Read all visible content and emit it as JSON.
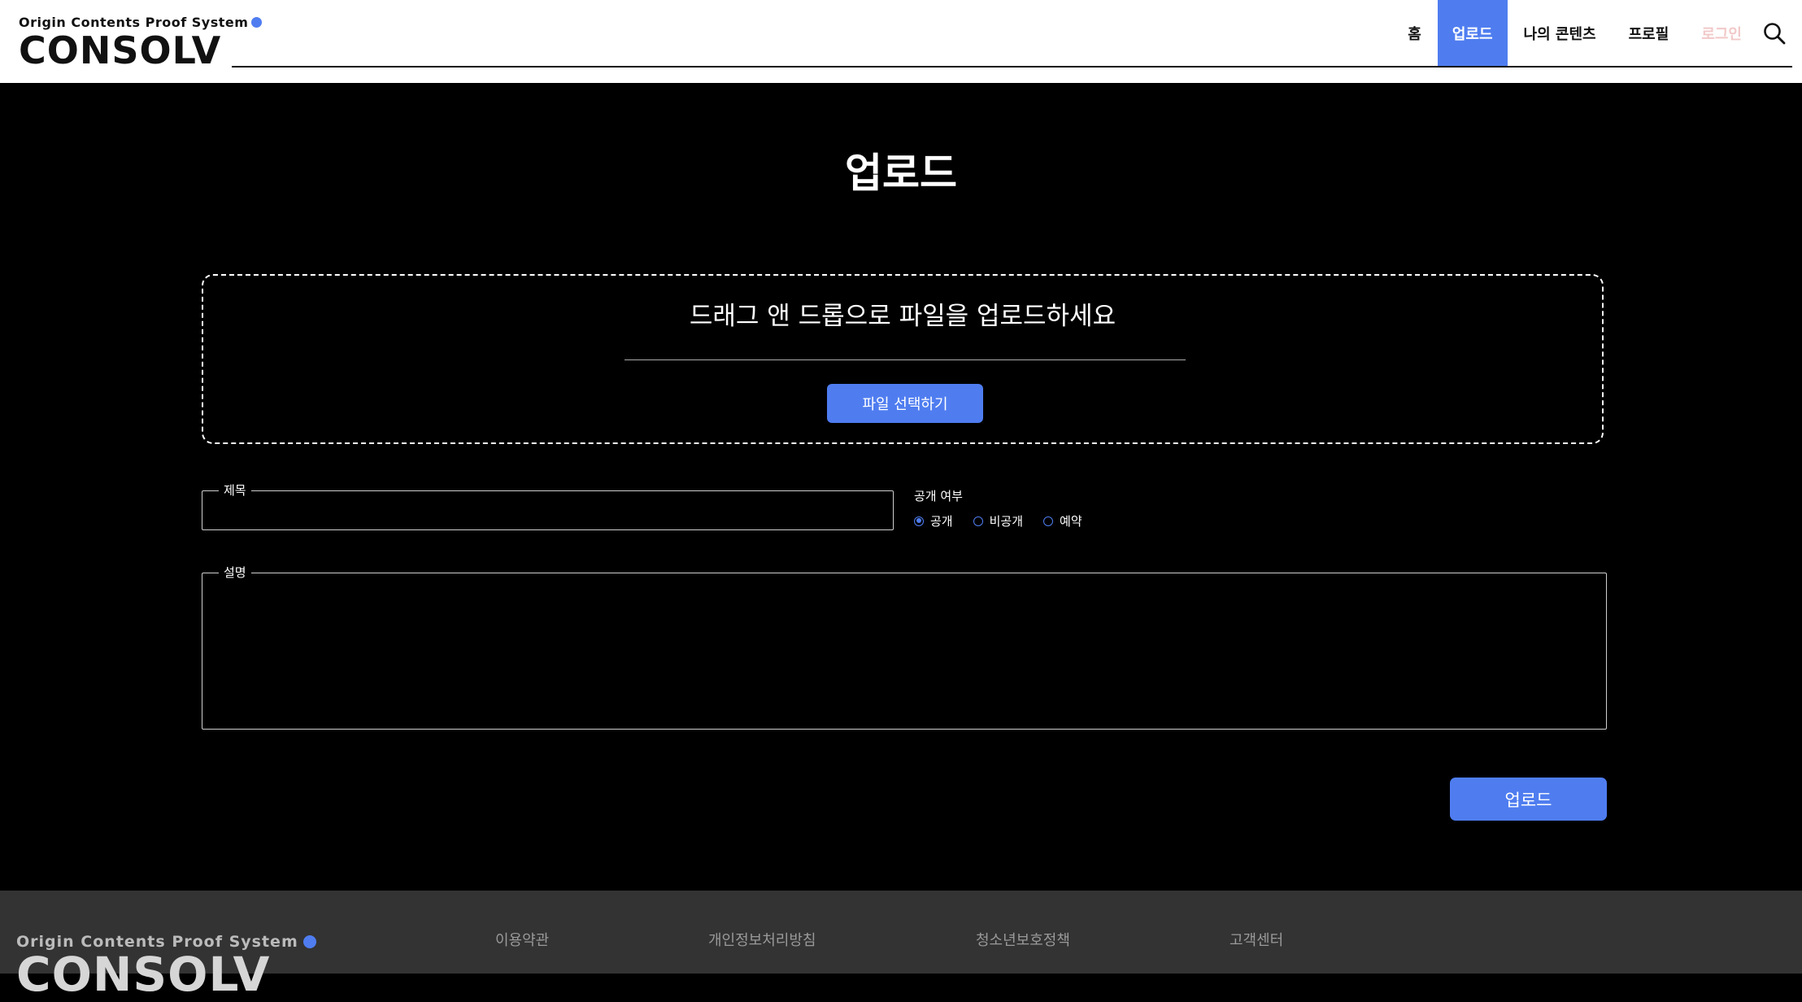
{
  "brand": {
    "tagline": "Origin Contents Proof System",
    "name": "CONSOLV",
    "accent_color": "#4f7df0"
  },
  "nav": {
    "items": [
      {
        "label": "홈"
      },
      {
        "label": "업로드",
        "active": true
      },
      {
        "label": "나의 콘텐츠"
      },
      {
        "label": "프로필"
      },
      {
        "label": "로그인"
      }
    ],
    "search_icon": "search-icon"
  },
  "page": {
    "title": "업로드"
  },
  "dropzone": {
    "text": "드래그 앤 드롭으로 파일을 업로드하세요",
    "button_label": "파일 선택하기"
  },
  "form": {
    "title_label": "제목",
    "title_value": "",
    "visibility_label": "공개 여부",
    "visibility_options": [
      {
        "label": "공개",
        "selected": true
      },
      {
        "label": "비공개",
        "selected": false
      },
      {
        "label": "예약",
        "selected": false
      }
    ],
    "description_label": "설명",
    "description_value": "",
    "submit_label": "업로드"
  },
  "footer": {
    "links": [
      {
        "label": "이용약관"
      },
      {
        "label": "개인정보처리방침"
      },
      {
        "label": "청소년보호정책"
      },
      {
        "label": "고객센터"
      }
    ]
  }
}
